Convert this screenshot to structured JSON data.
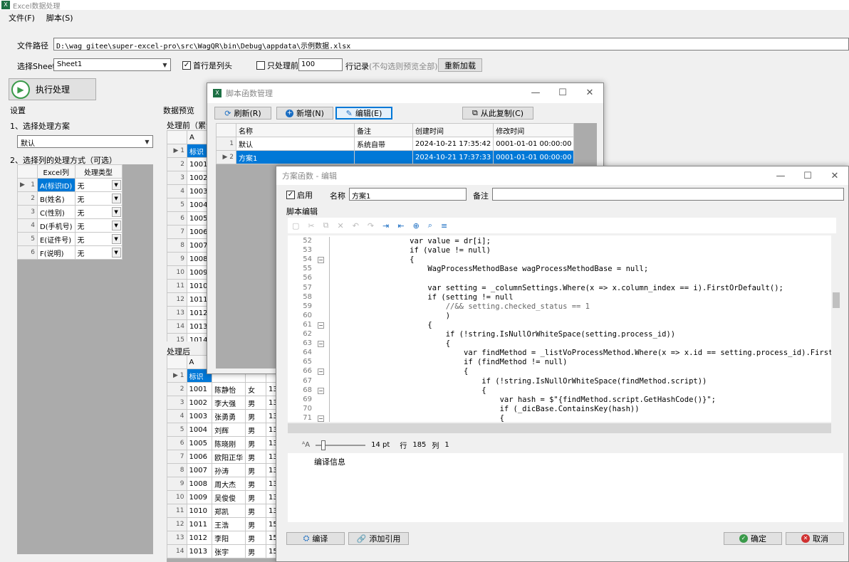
{
  "app": {
    "title": "Excel数据处理",
    "menu": [
      "文件(F)",
      "脚本(S)"
    ]
  },
  "file": {
    "label": "文件路径",
    "path": "D:\\wag_gitee\\super-excel-pro\\src\\WagQR\\bin\\Debug\\appdata\\示例数据.xlsx"
  },
  "sheet": {
    "label": "选择Sheet",
    "value": "Sheet1",
    "header_check_label": "首行是列头",
    "limit_label": "只处理前",
    "limit_value": "100",
    "records_label": "行记录",
    "hint": "(不勾选则预览全部)",
    "reload_label": "重新加载"
  },
  "run_label": "执行处理",
  "settings": {
    "title": "设置",
    "step1": "1、选择处理方案",
    "scheme_value": "默认",
    "step2": "2、选择列的处理方式（可选）",
    "col_headers": [
      "Excel列",
      "处理类型"
    ],
    "rows": [
      {
        "n": "1",
        "col": "A(标识ID)",
        "type": "无"
      },
      {
        "n": "2",
        "col": "B(姓名)",
        "type": "无"
      },
      {
        "n": "3",
        "col": "C(性别)",
        "type": "无"
      },
      {
        "n": "4",
        "col": "D(手机号)",
        "type": "无"
      },
      {
        "n": "5",
        "col": "E(证件号)",
        "type": "无"
      },
      {
        "n": "6",
        "col": "F(说明)",
        "type": "无"
      }
    ]
  },
  "preview": {
    "title": "数据预览",
    "before_label": "处理前（累计",
    "after_label": "处理后",
    "before_header": "A",
    "before_first": "标识",
    "before_rows": [
      "1001",
      "1002",
      "1003",
      "1004",
      "1005",
      "1006",
      "1007",
      "1008",
      "1009",
      "1010",
      "1011",
      "1012",
      "1013",
      "1014"
    ],
    "after_header": "A",
    "after_first": "标识",
    "after_rows": [
      {
        "n": "2",
        "id": "1001",
        "name": "陈静怡",
        "sex": "女",
        "x": "13"
      },
      {
        "n": "3",
        "id": "1002",
        "name": "李大强",
        "sex": "男",
        "x": "13"
      },
      {
        "n": "4",
        "id": "1003",
        "name": "张勇勇",
        "sex": "男",
        "x": "13"
      },
      {
        "n": "5",
        "id": "1004",
        "name": "刘辉",
        "sex": "男",
        "x": "13"
      },
      {
        "n": "6",
        "id": "1005",
        "name": "陈晓刚",
        "sex": "男",
        "x": "13"
      },
      {
        "n": "7",
        "id": "1006",
        "name": "欧阳正华",
        "sex": "男",
        "x": "13"
      },
      {
        "n": "8",
        "id": "1007",
        "name": "孙涛",
        "sex": "男",
        "x": "13"
      },
      {
        "n": "9",
        "id": "1008",
        "name": "周大杰",
        "sex": "男",
        "x": "13"
      },
      {
        "n": "10",
        "id": "1009",
        "name": "吴俊俊",
        "sex": "男",
        "x": "13"
      },
      {
        "n": "11",
        "id": "1010",
        "name": "郑凯",
        "sex": "男",
        "x": "13"
      },
      {
        "n": "12",
        "id": "1011",
        "name": "王浩",
        "sex": "男",
        "x": "15"
      },
      {
        "n": "13",
        "id": "1012",
        "name": "李阳",
        "sex": "男",
        "x": "15"
      },
      {
        "n": "14",
        "id": "1013",
        "name": "张宇",
        "sex": "男",
        "x": "15"
      }
    ]
  },
  "mgr": {
    "title": "脚本函数管理",
    "refresh": "刷新(R)",
    "add": "新增(N)",
    "edit": "编辑(E)",
    "copy": "从此复制(C)",
    "headers": [
      "名称",
      "备注",
      "创建时间",
      "修改时间"
    ],
    "rows": [
      {
        "n": "1",
        "name": "默认",
        "note": "系统自带",
        "created": "2024-10-21 17:35:42",
        "modified": "0001-01-01 00:00:00"
      },
      {
        "n": "2",
        "name": "方案1",
        "note": "",
        "created": "2024-10-21 17:37:33",
        "modified": "0001-01-01 00:00:00"
      }
    ]
  },
  "editor": {
    "title": "方案函数 - 编辑",
    "enable_label": "启用",
    "name_label": "名称",
    "name_value": "方案1",
    "note_label": "备注",
    "note_value": "",
    "script_label": "脚本编辑",
    "lines": [
      {
        "n": "52",
        "t": "                var value = dr[i];"
      },
      {
        "n": "53",
        "t": "                if (value != null)"
      },
      {
        "n": "54",
        "t": "                {"
      },
      {
        "n": "55",
        "t": "                    WagProcessMethodBase wagProcessMethodBase = null;"
      },
      {
        "n": "56",
        "t": ""
      },
      {
        "n": "57",
        "t": "                    var setting = _columnSettings.Where(x => x.column_index == i).FirstOrDefault();"
      },
      {
        "n": "58",
        "t": "                    if (setting != null"
      },
      {
        "n": "59",
        "t": "                        //&& setting.checked_status == 1"
      },
      {
        "n": "60",
        "t": "                        )"
      },
      {
        "n": "61",
        "t": "                    {"
      },
      {
        "n": "62",
        "t": "                        if (!string.IsNullOrWhiteSpace(setting.process_id))"
      },
      {
        "n": "63",
        "t": "                        {"
      },
      {
        "n": "64",
        "t": "                            var findMethod = _listVoProcessMethod.Where(x => x.id == setting.process_id).FirstOrDefault();"
      },
      {
        "n": "65",
        "t": "                            if (findMethod != null)"
      },
      {
        "n": "66",
        "t": "                            {"
      },
      {
        "n": "67",
        "t": "                                if (!string.IsNullOrWhiteSpace(findMethod.script))"
      },
      {
        "n": "68",
        "t": "                                {"
      },
      {
        "n": "69",
        "t": "                                    var hash = $\"{findMethod.script.GetHashCode()}\";"
      },
      {
        "n": "70",
        "t": "                                    if (_dicBase.ContainsKey(hash))"
      },
      {
        "n": "71",
        "t": "                                    {"
      }
    ],
    "font_size": "14 pt",
    "row_label": "行",
    "row_value": "185",
    "col_label": "列",
    "col_value": "1",
    "compile_info": "编译信息",
    "compile_btn": "编译",
    "add_ref_btn": "添加引用",
    "ok_btn": "确定",
    "cancel_btn": "取消"
  }
}
